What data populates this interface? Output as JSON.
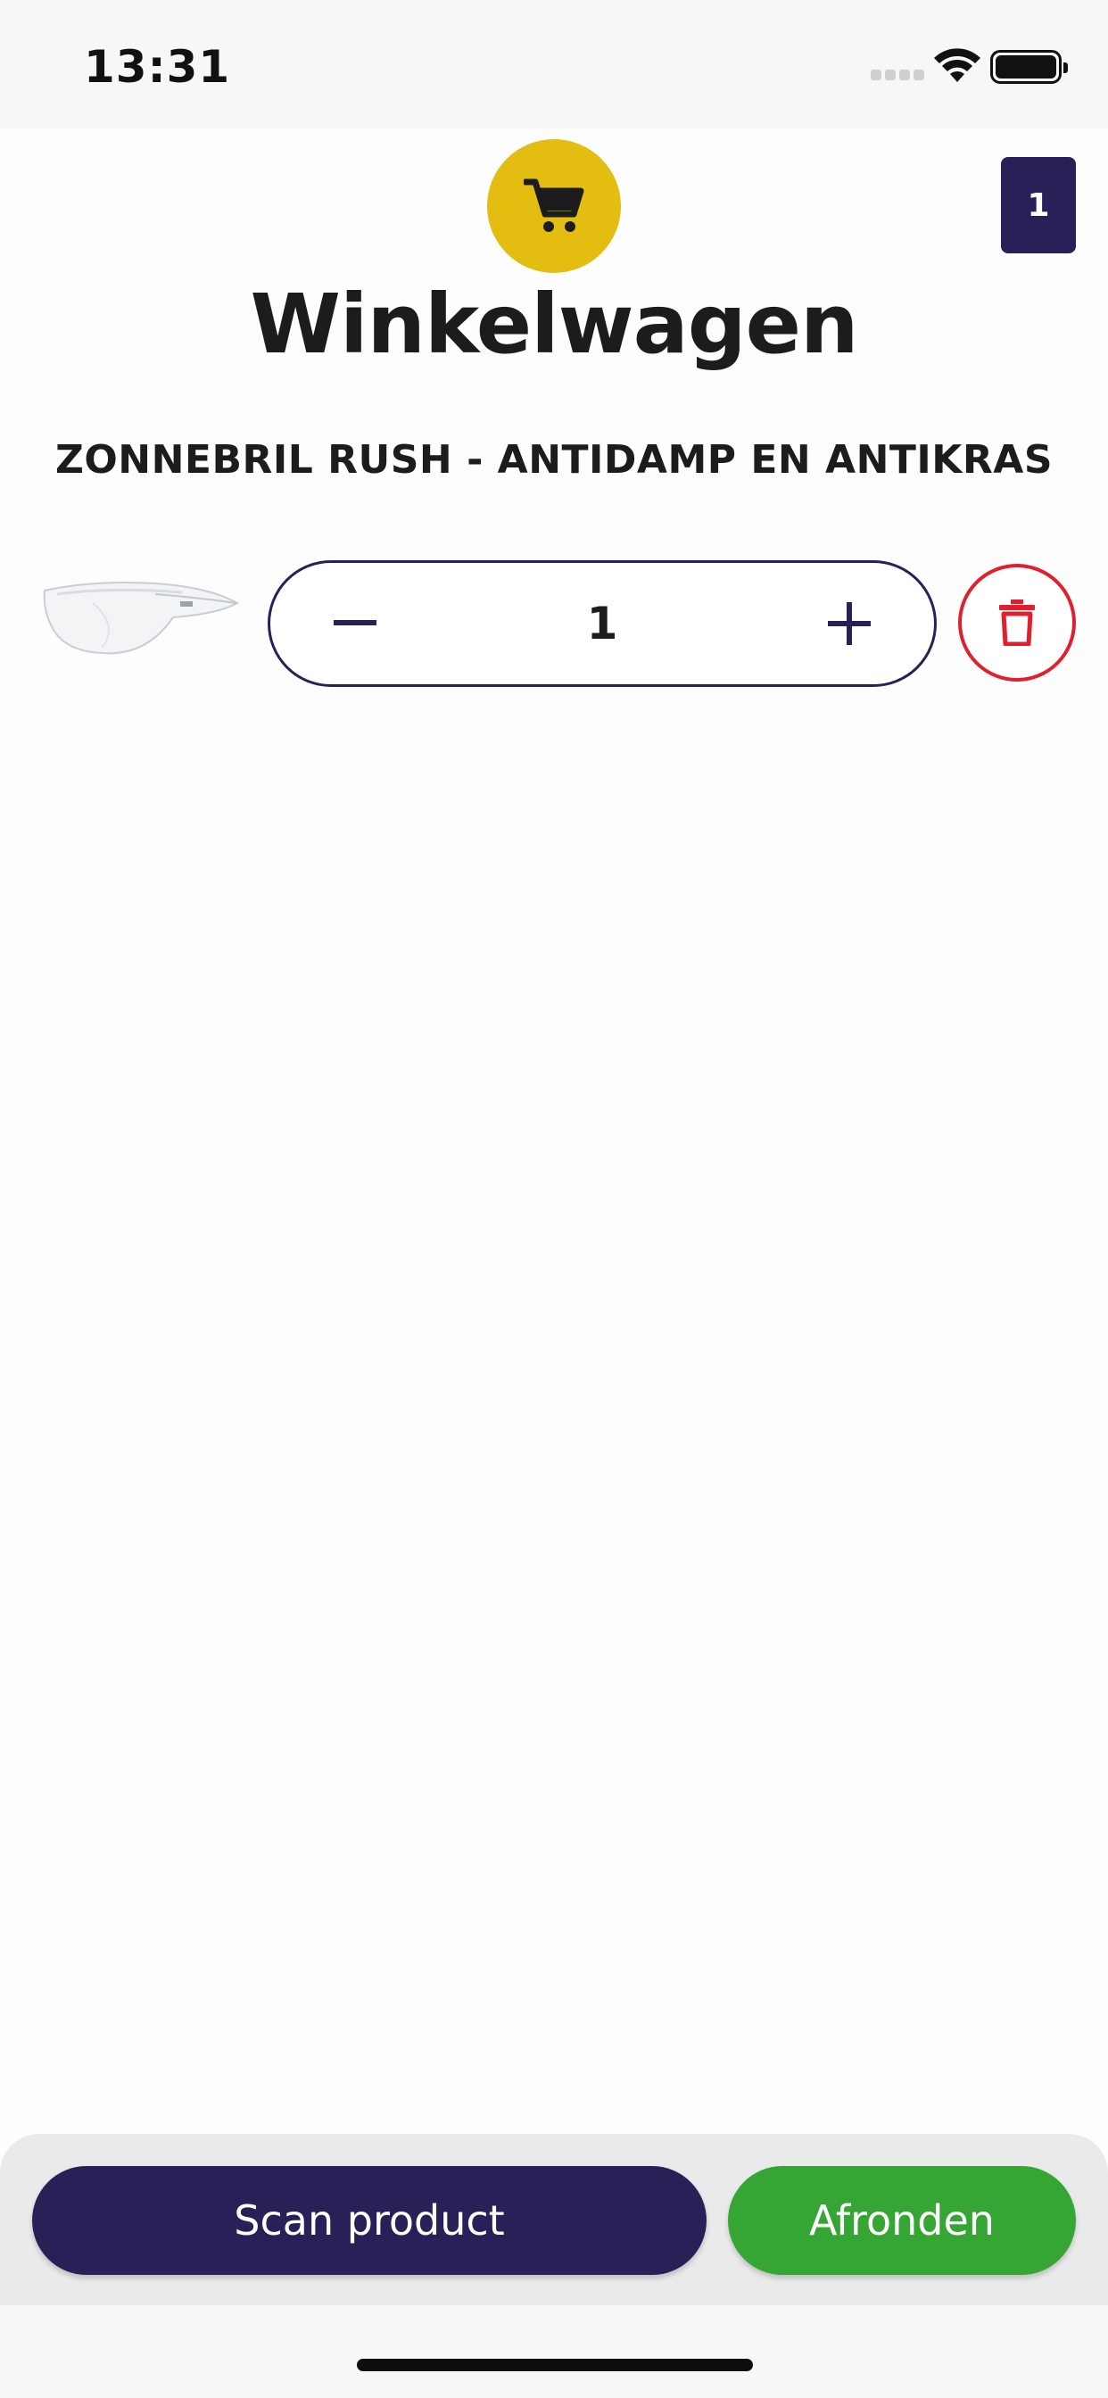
{
  "status_bar": {
    "time": "13:31",
    "icons": [
      "cellular-signal-icon",
      "wifi-icon",
      "battery-icon"
    ]
  },
  "header": {
    "icon": "shopping-cart-icon",
    "icon_background": "#e3bd10",
    "cart_count": "1",
    "title": "Winkelwagen"
  },
  "cart": {
    "items": [
      {
        "name": "ZONNEBRIL RUSH - ANTIDAMP EN ANTIKRAS",
        "thumbnail": "safety-glasses-image",
        "quantity": "1",
        "decrement_icon": "minus-icon",
        "increment_icon": "plus-icon",
        "delete_icon": "trash-icon"
      }
    ]
  },
  "actions": {
    "scan_label": "Scan product",
    "finish_label": "Afronden"
  },
  "colors": {
    "primary": "#2a2058",
    "accent_yellow": "#e3bd10",
    "success_green": "#35a634",
    "danger_red": "#e0202c"
  }
}
